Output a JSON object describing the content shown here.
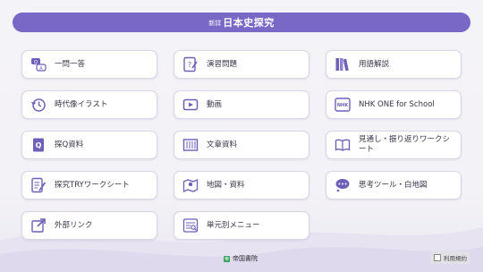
{
  "header": {
    "prefix": "新詳",
    "title": "日本史探究"
  },
  "menu": [
    {
      "label": "一問一答",
      "icon": "qa-bubbles-icon"
    },
    {
      "label": "演習問題",
      "icon": "exercise-sheet-icon"
    },
    {
      "label": "用語解説",
      "icon": "books-icon"
    },
    {
      "label": "時代像イラスト",
      "icon": "clock-history-icon"
    },
    {
      "label": "動画",
      "icon": "video-play-icon"
    },
    {
      "label": "NHK ONE for School",
      "icon": "nhk-logo-icon"
    },
    {
      "label": "探Q資料",
      "icon": "search-q-doc-icon"
    },
    {
      "label": "文章資料",
      "icon": "scroll-icon"
    },
    {
      "label": "見通し・振り返りワークシート",
      "icon": "open-book-icon"
    },
    {
      "label": "探究TRYワークシート",
      "icon": "worksheet-pen-icon"
    },
    {
      "label": "地図・資料",
      "icon": "map-pin-icon"
    },
    {
      "label": "思考ツール・白地図",
      "icon": "thought-bubble-icon"
    },
    {
      "label": "外部リンク",
      "icon": "external-link-icon"
    },
    {
      "label": "単元別メニュー",
      "icon": "unit-menu-icon"
    }
  ],
  "footer": {
    "publisher": "帝国書院",
    "terms": "利用規約"
  },
  "colors": {
    "accent": "#7a68c6",
    "icon": "#6e5fb8"
  }
}
